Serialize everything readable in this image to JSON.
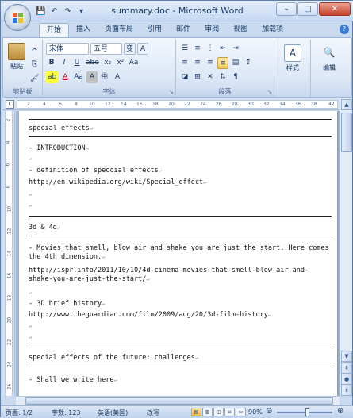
{
  "window": {
    "title": "summary.doc - Microsoft Word",
    "controls": {
      "minimize": "–",
      "maximize": "□",
      "close": "✕"
    }
  },
  "quick_access": {
    "save": "💾",
    "undo": "↶",
    "redo": "↷",
    "more": "▾"
  },
  "tabs": [
    "开始",
    "插入",
    "页面布局",
    "引用",
    "邮件",
    "审阅",
    "视图",
    "加载项"
  ],
  "active_tab": "开始",
  "ribbon": {
    "clipboard": {
      "paste_label": "粘贴",
      "group_label": "剪贴板"
    },
    "font": {
      "font_name": "宋体",
      "font_size": "五号",
      "group_label": "字体",
      "row2": [
        "B",
        "I",
        "U",
        "abe",
        "x₂",
        "x²",
        "Aa"
      ],
      "row3": [
        "ab",
        "A",
        "Aa",
        "A",
        "A"
      ]
    },
    "paragraph": {
      "group_label": "段落"
    },
    "styles": {
      "label": "样式"
    },
    "editing": {
      "label": "编辑"
    }
  },
  "ruler": {
    "marks": [
      "2",
      "4",
      "6",
      "8",
      "10",
      "12",
      "14",
      "16",
      "18",
      "20",
      "22",
      "24",
      "26",
      "28",
      "30",
      "32",
      "34",
      "36",
      "38",
      "42"
    ],
    "tab_selector": "L",
    "vertical_marks": [
      "2",
      "4",
      "6",
      "8",
      "10",
      "12",
      "14",
      "16",
      "18",
      "20",
      "22",
      "24",
      "26"
    ]
  },
  "document": {
    "lines": {
      "l1": "special effects",
      "l2": "- INTRODUCTION",
      "l3": "- definition of speccial effects",
      "l4": "http://en.wikipedia.org/wiki/Special_effect",
      "l5": "3d & 4d",
      "l6": "- Movies that smell, blow air and shake you are just the start. Here comes the 4th dimension.",
      "l7": "http://ispr.info/2011/10/10/4d-cinema-movies-that-smell-blow-air-and-shake-you-are-just-the-start/",
      "l8": "- 3D brief history",
      "l9": "http://www.theguardian.com/film/2009/aug/20/3d-film-history",
      "l10": "special effects of the future: challenges",
      "l11": "- Shall we write here"
    },
    "para_mark": "↵"
  },
  "statusbar": {
    "page": "页面: 1/2",
    "words": "字数: 123",
    "language": "英语(美国)",
    "mode": "改写",
    "zoom": "90%",
    "zoom_out": "⊖",
    "zoom_in": "⊕"
  }
}
